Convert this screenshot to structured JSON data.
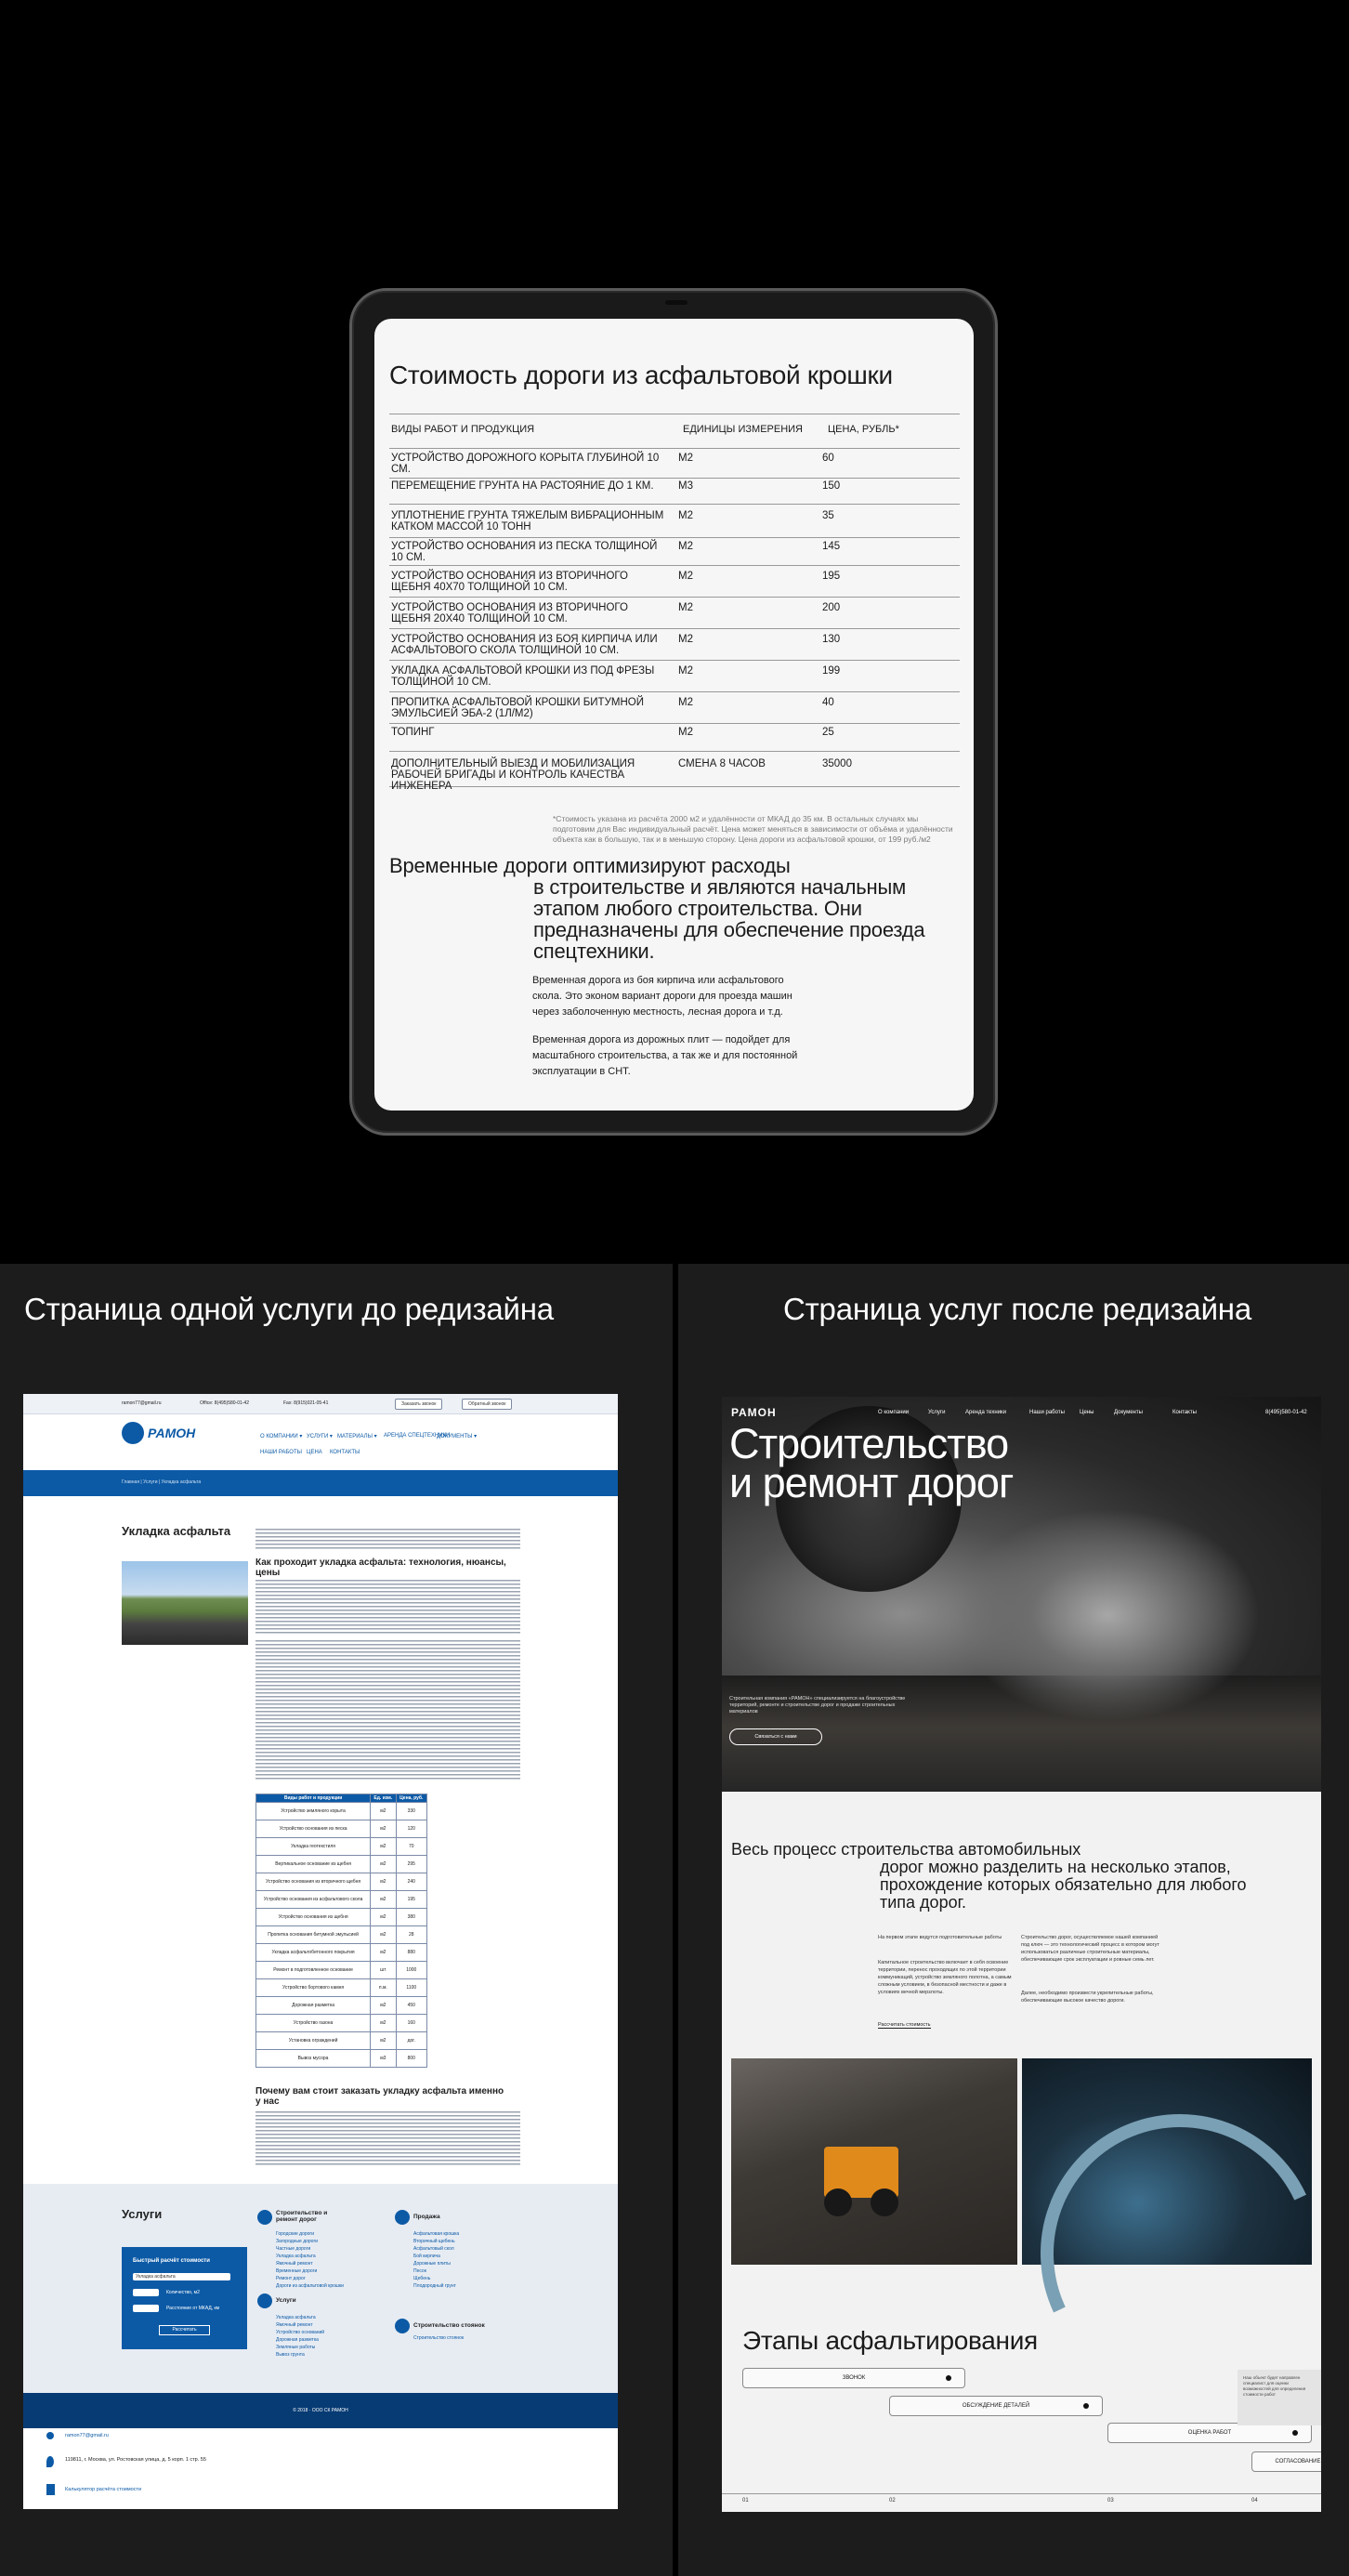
{
  "tablet": {
    "price_title": "Стоимость дороги из асфальтовой крошки",
    "headers": {
      "work": "ВИДЫ РАБОТ И ПРОДУКЦИЯ",
      "unit": "ЕДИНИЦЫ ИЗМЕРЕНИЯ",
      "price": "ЦЕНА, РУБЛЬ*"
    },
    "rows": [
      {
        "name": "УСТРОЙСТВО ДОРОЖНОГО КОРЫТА ГЛУБИНОЙ 10 СМ.",
        "unit": "м2",
        "price": "60"
      },
      {
        "name": "ПЕРЕМЕЩЕНИЕ ГРУНТА НА РАСТОЯНИЕ ДО 1 КМ.",
        "unit": "м3",
        "price": "150"
      },
      {
        "name": "УПЛОТНЕНИЕ ГРУНТА ТЯЖЕЛЫМ ВИБРАЦИОННЫМ КАТКОМ МАССОЙ 10 ТОНН",
        "unit": "м2",
        "price": "35"
      },
      {
        "name": "УСТРОЙСТВО ОСНОВАНИЯ ИЗ ПЕСКА ТОЛЩИНОЙ 10 СМ.",
        "unit": "м2",
        "price": "145"
      },
      {
        "name": "УСТРОЙСТВО ОСНОВАНИЯ ИЗ ВТОРИЧНОГО ЩЕБНЯ 40Х70 ТОЛЩИНОЙ 10 СМ.",
        "unit": "м2",
        "price": "195"
      },
      {
        "name": "УСТРОЙСТВО ОСНОВАНИЯ ИЗ ВТОРИЧНОГО ЩЕБНЯ 20Х40 ТОЛЩИНОЙ 10 СМ.",
        "unit": "м2",
        "price": "200"
      },
      {
        "name": "УСТРОЙСТВО ОСНОВАНИЯ ИЗ БОЯ КИРПИЧА ИЛИ АСФАЛЬТОВОГО СКОЛА ТОЛЩИНОЙ 10 СМ.",
        "unit": "м2",
        "price": "130"
      },
      {
        "name": "УКЛАДКА АСФАЛЬТОВОЙ КРОШКИ ИЗ ПОД ФРЕЗЫ ТОЛЩИНОЙ 10 СМ.",
        "unit": "м2",
        "price": "199"
      },
      {
        "name": "ПРОПИТКА АСФАЛЬТОВОЙ КРОШКИ БИТУМНОЙ ЭМУЛЬСИЕЙ ЭБА-2 (1Л/М2)",
        "unit": "м2",
        "price": "40"
      },
      {
        "name": "ТОПИНГ",
        "unit": "м2",
        "price": "25"
      },
      {
        "name": "ДОПОЛНИТЕЛЬНЫЙ ВЫЕЗД И МОБИЛИЗАЦИЯ РАБОЧЕЙ БРИГАДЫ И КОНТРОЛЬ КАЧЕСТВА ИНЖЕНЕРА",
        "unit": "смена 8 часов",
        "price": "35000"
      }
    ],
    "note": "*Стоимость указана из расчёта 2000 м2 и удалённости от МКАД до 35 км. В остальных случаях мы подготовим для Вас индивидуальный расчёт. Цена может меняться в зависимости от объёма и удалённости объекта как в большую, так и в меньшую сторону. Цена дороги из асфальтовой крошки, от 199 руб./м2",
    "heading_line1": "Временные дороги оптимизируют расходы",
    "heading_line2": "в строительстве и являются начальным этапом любого строительства. Они предназначены для обеспечение проезда спецтехники.",
    "p1": "Временная дорога из боя кирпича или асфальтового скола. Это эконом вариант дороги для проезда машин через заболоченную местность, лесная дорога и т.д.",
    "p2": "Временная дорога из дорожных плит — подойдет для масштабного строительства, а так же и для постоянной эксплуатации в СНТ."
  },
  "panels": {
    "left_title": "Страница одной услуги до редизайна",
    "right_title": "Страница услуг после редизайна"
  },
  "old_site": {
    "email": "ramon77@gmail.ru",
    "office": "Office: 8(495)580-01-42",
    "fax": "Fax: 8(915)021-05-41",
    "btn_call": "Заказать звонок",
    "btn_feedback": "Обратный звонок",
    "logo": "РАМОН",
    "nav1": [
      "О КОМПАНИИ ▾",
      "УСЛУГИ ▾",
      "МАТЕРИАЛЫ ▾",
      "АРЕНДА СПЕЦТЕХНИКИ",
      "ДОКУМЕНТЫ ▾"
    ],
    "nav2": [
      "НАШИ РАБОТЫ",
      "ЦЕНА",
      "КОНТАКТЫ"
    ],
    "breadcrumb": "Главная   |   Услуги   |   Укладка асфальта",
    "h1": "Укладка асфальта",
    "h2": "Как проходит укладка асфальта: технология, нюансы, цены",
    "h3": "Почему вам стоит заказать укладку асфальта именно у нас",
    "table_header": [
      "Виды работ и продукции",
      "Ед. изм.",
      "Цена, руб."
    ],
    "table_rows": [
      [
        "Устройство земляного корыта",
        "м2",
        "330"
      ],
      [
        "Устройство основания из песка",
        "м2",
        "120"
      ],
      [
        "Укладка геотекстиля",
        "м2",
        "70"
      ],
      [
        "Вертикальное основание из щебня",
        "м2",
        "295"
      ],
      [
        "Устройство основания из вторичного щебня",
        "м2",
        "240"
      ],
      [
        "Устройство основания из асфальтового скола",
        "м2",
        "195"
      ],
      [
        "Устройство основания из щебня",
        "м2",
        "380"
      ],
      [
        "Пропитка основания битумной эмульсией",
        "м2",
        "28"
      ],
      [
        "Укладка асфальтобетонного покрытия",
        "м2",
        "880"
      ],
      [
        "Ремонт в подготовленное основание",
        "шт",
        "1000"
      ],
      [
        "Устройство бортового камня",
        "п.м.",
        "1100"
      ],
      [
        "Дорожная разметка",
        "м2",
        "450"
      ],
      [
        "Устройство газона",
        "м2",
        "160"
      ],
      [
        "Установка ограждений",
        "м2",
        "дог."
      ],
      [
        "Вывоз мусора",
        "м3",
        "800"
      ]
    ],
    "services_title": "Услуги",
    "calc_title": "Быстрый расчёт стоимости",
    "calc_select": "Укладка асфальта",
    "calc_qty": "Количество, м2",
    "calc_dist": "Расстояние от МКАД, км",
    "calc_btn": "Рассчитать",
    "col1_title": "Строительство и ремонт дорог",
    "col1_items": [
      "Городские дороги",
      "Загородные дороги",
      "Частные дороги",
      "Укладка асфальта",
      "Ямочный ремонт",
      "Временные дороги",
      "Ремонт дорог",
      "Дороги из асфальтовой крошки"
    ],
    "col2_title": "Продажа",
    "col2_items": [
      "Асфальтовая крошка",
      "Вторичный щебень",
      "Асфальтовый скол",
      "Бой кирпича",
      "Дорожные плиты",
      "Песок",
      "Щебень",
      "Плодородный грунт"
    ],
    "col3_title": "Услуги",
    "col3_items": [
      "Укладка асфальта",
      "Ямочный ремонт",
      "Устройство оснований",
      "Дорожная разметка",
      "Земляные работы",
      "Вывоз грунта"
    ],
    "col4_title": "Строительство стоянок",
    "col4_items": [
      "Строительство стоянок"
    ],
    "footer": "© 2018 · ООО СК РАМОН",
    "contacts": [
      "ramon77@gmail.ru",
      "119811, г. Москва, ул. Ростовская улица, д. 5 корп. 1 стр. 55",
      "Калькулятор расчёта стоимости"
    ]
  },
  "new_site": {
    "logo": "РАМОН",
    "nav": [
      "О компании",
      "Услуги",
      "Аренда техники",
      "Наши работы",
      "Цены",
      "Документы",
      "Контакты"
    ],
    "phone": "8(495)580-01-42",
    "hero_title_1": "Строительство",
    "hero_title_2": "и ремонт дорог",
    "hero_sub": "Строительная компания «РАМОН» специализируется на благоустройстве территорий, ремонте и строительстве дорог и продаже строительных материалов",
    "hero_btn": "Связаться с нами",
    "stage_line1": "Весь процесс строительства автомобильных",
    "stage_line2": "дорог можно разделить на несколько этапов, прохождение которых обязательно для любого типа дорог.",
    "col_a1": "На первом этапе ведутся подготовительные работы",
    "col_a2": "Капитальное строительство включает в себя освоение территории, перенос проходящих по этой территории коммуникаций, устройство земляного полотна, а самым сложным условием, в безопасной местности и даже в условиях вечной мерзлоты.",
    "col_b1": "Строительство дорог, осуществляемое нашей компанией под ключ — это технологический процесс в котором могут использоваться различные строительные материалы, обеспечивающие срок эксплуатации и ровные семь лет.",
    "col_b2": "Далее, необходимо произвести укрепительные работы, обеспечивающие высокое качество дороги.",
    "link": "Рассчитать стоимость",
    "asph_title": "Этапы асфальтирования",
    "steps": [
      "ЗВОНОК",
      "ОБСУЖДЕНИЕ ДЕТАЛЕЙ",
      "ОЦЕНКА РАБОТ",
      "СОГЛАСОВАНИЕ"
    ],
    "tip": "Наш объект будет направлен специалист для оценки возможностей для определения стоимости работ",
    "nums": [
      "01",
      "02",
      "03",
      "04"
    ]
  }
}
